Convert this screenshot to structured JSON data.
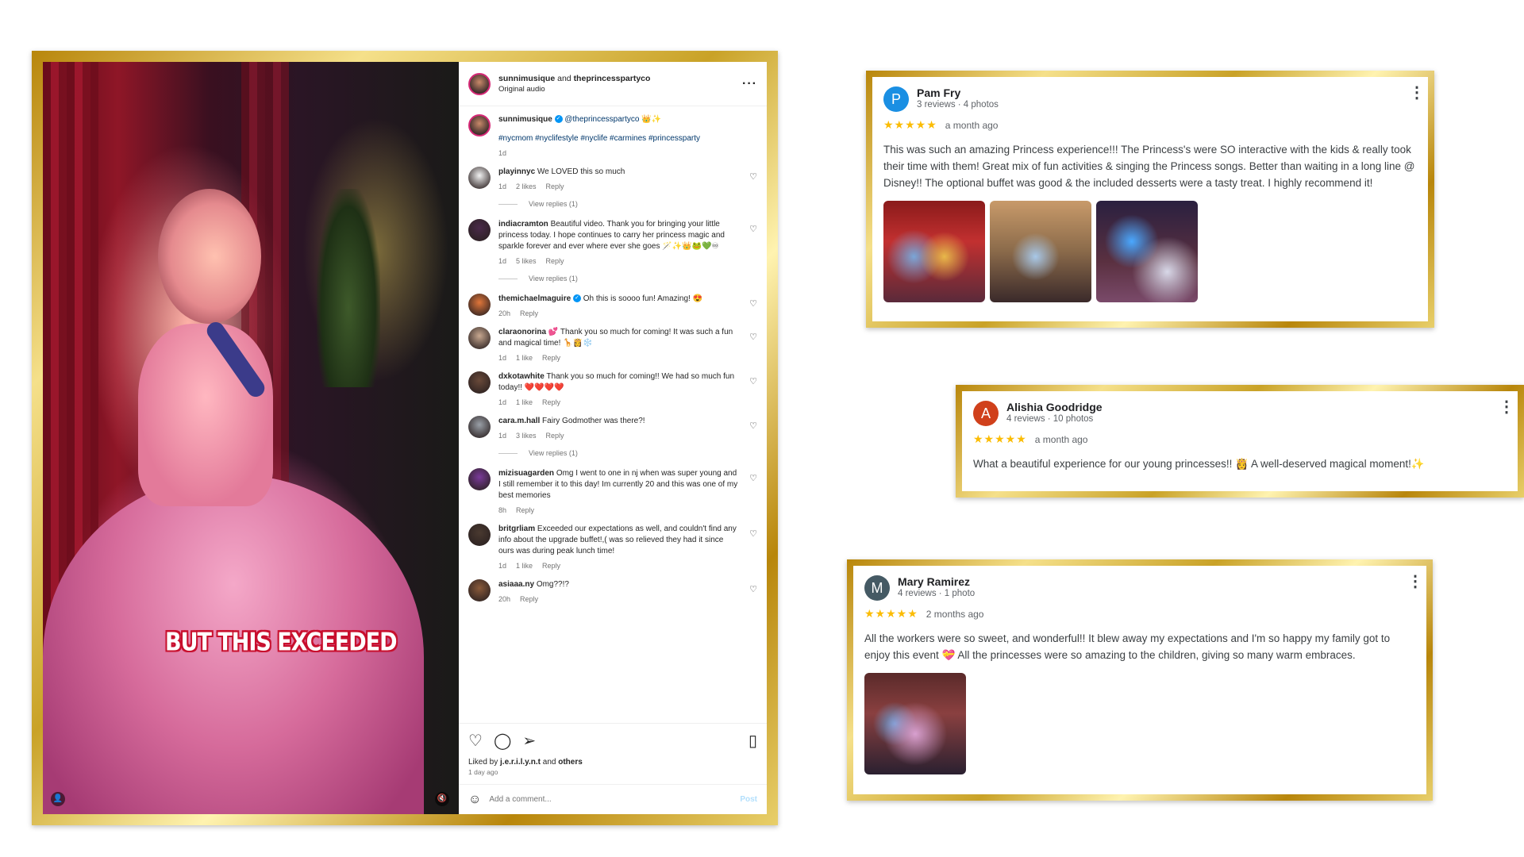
{
  "instagram": {
    "header": {
      "user1": "sunnimusique",
      "joiner": "and",
      "user2": "theprincesspartyco",
      "audio": "Original audio"
    },
    "caption_overlay": "BUT THIS EXCEEDED",
    "caption": {
      "username": "sunnimusique",
      "mention": "@theprincesspartyco",
      "emojis": "👑✨",
      "hashtags": "#nycmom #nyclifestyle #nyclife #carmines #princessparty",
      "time": "1d"
    },
    "comments": [
      {
        "username": "playinnyc",
        "text": "We LOVED this so much",
        "time": "1d",
        "likes": "2 likes",
        "reply": "Reply",
        "view_replies": "View replies (1)",
        "avatar_color": "#f2f2f2"
      },
      {
        "username": "indiacramton",
        "text": "Beautiful video. Thank you for bringing your little princess today. I hope continues to carry her princess magic and sparkle forever and ever where ever she goes 🪄✨👑🐸💚♾",
        "time": "1d",
        "likes": "5 likes",
        "reply": "Reply",
        "view_replies": "View replies (1)",
        "avatar_color": "#4a2a4a"
      },
      {
        "username": "themichaelmaguire",
        "text": "Oh this is soooo fun! Amazing! 😍",
        "time": "20h",
        "likes": "",
        "reply": "Reply",
        "view_replies": "",
        "avatar_color": "#e0763a",
        "verified": true
      },
      {
        "username": "claraonorina",
        "text": "💕 Thank you so much for coming! It was such a fun and magical time! 🦒👸❄️",
        "time": "1d",
        "likes": "1 like",
        "reply": "Reply",
        "view_replies": "",
        "avatar_color": "#c8a890"
      },
      {
        "username": "dxkotawhite",
        "text": "Thank you so much for coming!! We had so much fun today!! ❤️❤️❤️❤️",
        "time": "1d",
        "likes": "1 like",
        "reply": "Reply",
        "view_replies": "",
        "avatar_color": "#6a4a3a"
      },
      {
        "username": "cara.m.hall",
        "text": "Fairy Godmother was there?!",
        "time": "1d",
        "likes": "3 likes",
        "reply": "Reply",
        "view_replies": "View replies (1)",
        "avatar_color": "#9aa0a8"
      },
      {
        "username": "mizisuagarden",
        "text": "Omg I went to one in nj when was super young and I still remember it to this day! Im currently 20 and this was one of my best memories",
        "time": "8h",
        "likes": "",
        "reply": "Reply",
        "view_replies": "",
        "avatar_color": "#7a3a9a"
      },
      {
        "username": "britgrliam",
        "text": "Exceeded our expectations as well, and couldn't find any info about the upgrade buffet!,( was so relieved they had it since ours was during peak lunch time!",
        "time": "1d",
        "likes": "1 like",
        "reply": "Reply",
        "view_replies": "",
        "avatar_color": "#4a3a30"
      },
      {
        "username": "asiaaa.ny",
        "text": "Omg??!?",
        "time": "20h",
        "likes": "",
        "reply": "Reply",
        "view_replies": "",
        "avatar_color": "#8a5a3a"
      }
    ],
    "liked_by_prefix": "Liked by",
    "liked_by_user": "j.e.r.i.l.y.n.t",
    "liked_by_and": "and",
    "liked_by_others": "others",
    "post_age": "1 day ago",
    "comment_placeholder": "Add a comment...",
    "post_label": "Post"
  },
  "reviews": [
    {
      "initial": "P",
      "avatar_color": "#1a8fe3",
      "name": "Pam Fry",
      "sub": "3 reviews · 4 photos",
      "stars": "★★★★★",
      "date": "a month ago",
      "text": "This was such an amazing Princess experience!!! The Princess's were SO interactive with the kids & really took their time with them! Great mix of fun activities & singing the Princess songs. Better than waiting in a long line @ Disney!! The optional buffet was good & the included desserts were a tasty treat. I highly recommend it!",
      "photo_count": 3
    },
    {
      "initial": "A",
      "avatar_color": "#d0401b",
      "name": "Alishia Goodridge",
      "sub": "4 reviews · 10 photos",
      "stars": "★★★★★",
      "date": "a month ago",
      "text": "What a beautiful experience for our young princesses!! 👸 A well-deserved magical moment!✨",
      "photo_count": 0
    },
    {
      "initial": "M",
      "avatar_color": "#455a64",
      "name": "Mary Ramirez",
      "sub": "4 reviews · 1 photo",
      "stars": "★★★★★",
      "date": "2 months ago",
      "text": "All the workers were so sweet, and wonderful!! It blew away my expectations and I'm so happy my family got to enjoy this event 💝 All the princesses were so amazing to the children, giving so many warm embraces.",
      "photo_count": 1
    }
  ]
}
